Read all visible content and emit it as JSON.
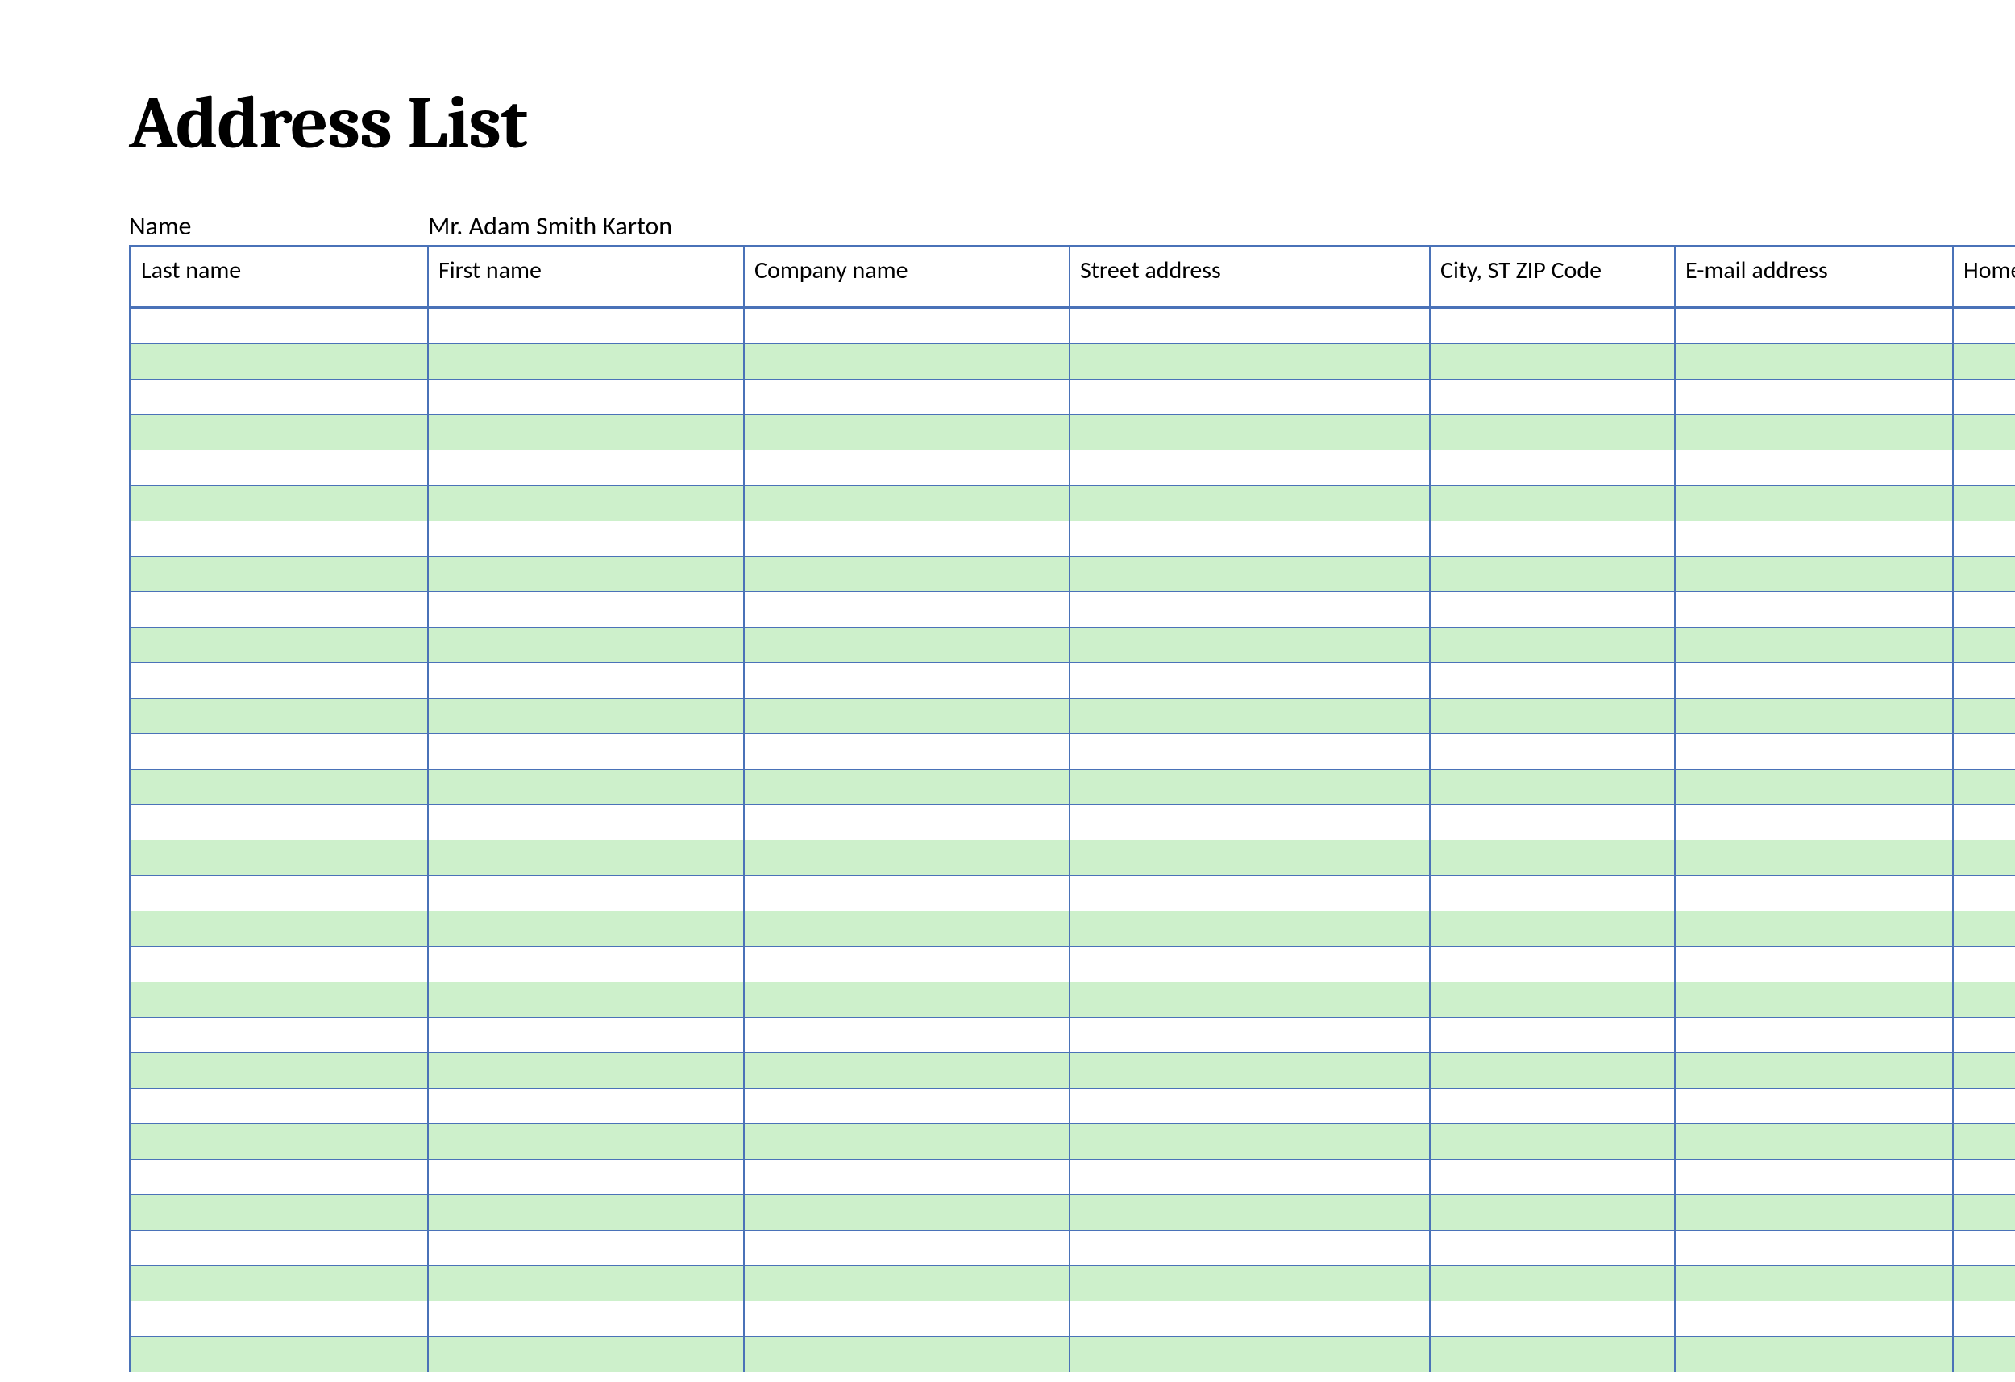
{
  "title": "Address List",
  "name_label": "Name",
  "name_value": "Mr. Adam Smith Karton",
  "columns": [
    "Last name",
    "First name",
    "Company name",
    "Street address",
    "City, ST  ZIP Code",
    "E-mail address",
    "Home"
  ],
  "row_count": 30,
  "colors": {
    "border": "#4a72b8",
    "alt_row": "#cdf0cb"
  }
}
